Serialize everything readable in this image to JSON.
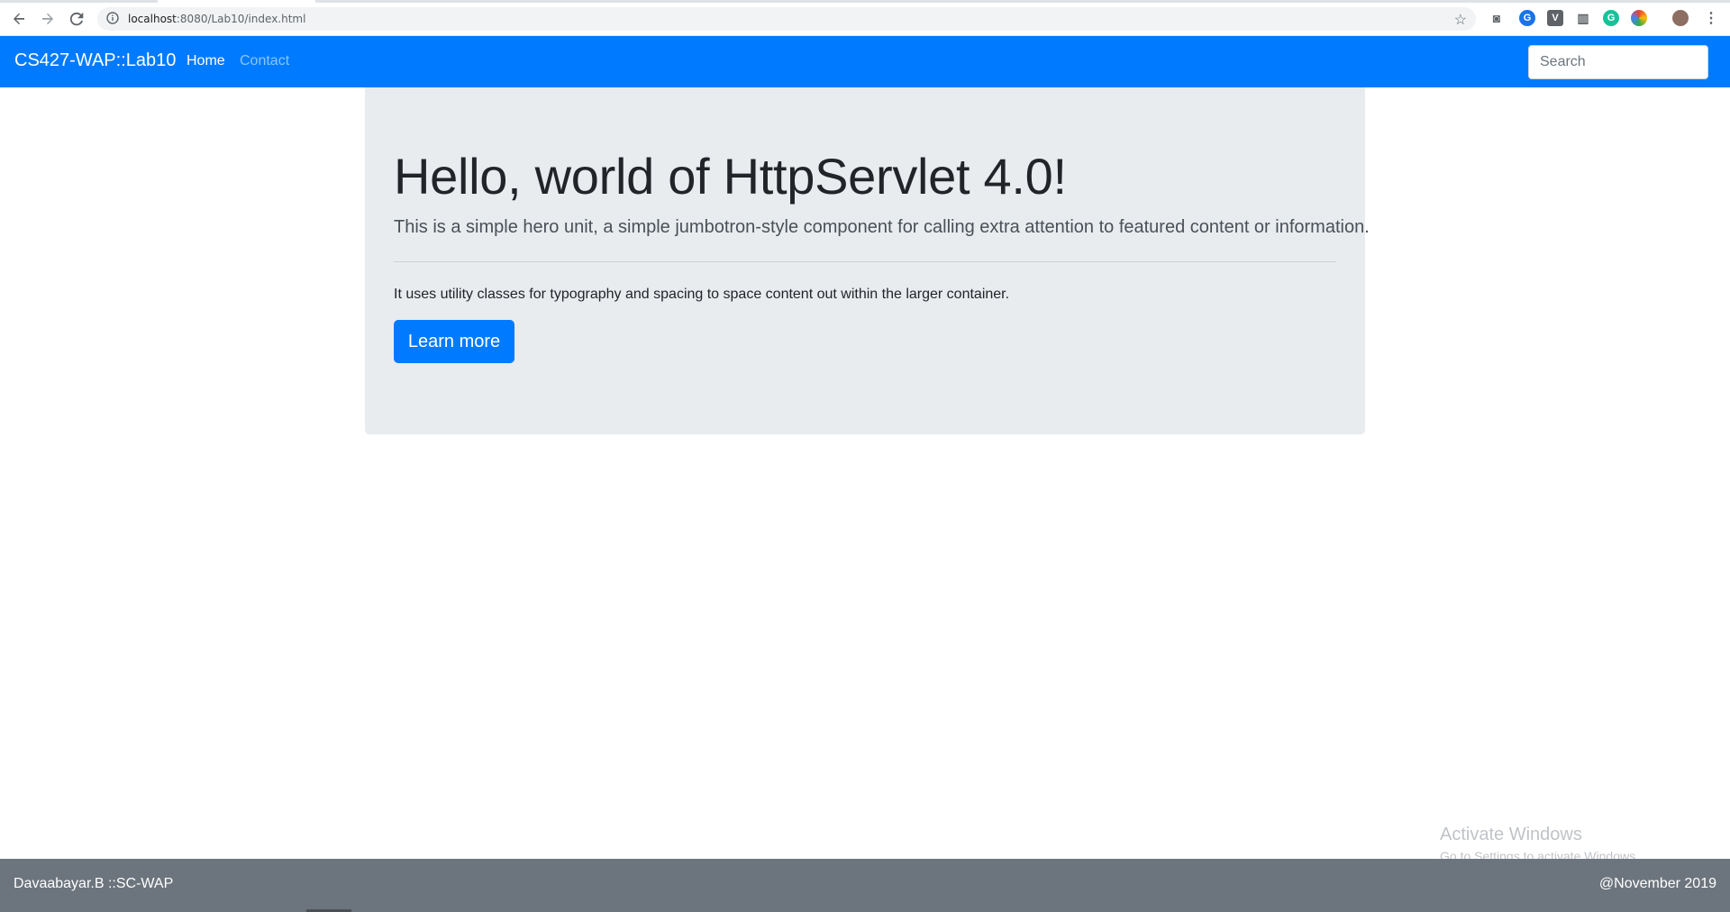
{
  "browser": {
    "url_host": "localhost",
    "url_rest": ":8080/Lab10/index.html",
    "extensions": [
      "camera-icon",
      "translate-icon",
      "v-extension-icon",
      "stats-icon",
      "grammarly-icon",
      "color-icon",
      "avatar"
    ]
  },
  "navbar": {
    "brand": "CS427-WAP::Lab10",
    "links": [
      {
        "label": "Home",
        "active": true
      },
      {
        "label": "Contact",
        "active": false
      }
    ],
    "search_placeholder": "Search"
  },
  "jumbotron": {
    "title": "Hello, world of HttpServlet 4.0!",
    "lead": "This is a simple hero unit, a simple jumbotron-style component for calling extra attention to featured content or information.",
    "body": "It uses utility classes for typography and spacing to space content out within the larger container.",
    "button": "Learn more"
  },
  "watermark": {
    "title": "Activate Windows",
    "subtitle": "Go to Settings to activate Windows."
  },
  "footer": {
    "left": "Davaabayar.B ::SC-WAP",
    "right": "@November 2019"
  },
  "colors": {
    "primary": "#007bff",
    "jumbotron_bg": "#e9ecef",
    "footer_bg": "#6c757d"
  }
}
